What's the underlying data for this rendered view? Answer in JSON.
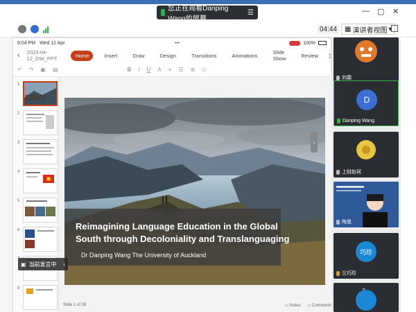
{
  "meeting": {
    "share_banner": "您正在观看Danping Wang的屏幕",
    "timer": "04:44",
    "view_label": "演讲者视图",
    "sharing_tag": "当前发言中"
  },
  "ipad": {
    "time": "6:04 PM",
    "date": "Wed 12 Apr",
    "dots": "•••",
    "battery": "100%"
  },
  "ppt": {
    "filename": "2023-04-12_DW_PPT",
    "tabs": [
      "Home",
      "Insert",
      "Draw",
      "Design",
      "Transitions",
      "Animations",
      "Slide Show",
      "Review"
    ],
    "active_tab": "Home",
    "slide_counter": "Slide 1 of 38",
    "notes_label": "Notes",
    "comments_label": "Comments",
    "thumb_numbers": [
      "1",
      "2",
      "3",
      "4",
      "5",
      "6",
      "7",
      "8"
    ]
  },
  "slide": {
    "title": "Reimagining Language Education in the Global South through Decoloniality and Translanguaging",
    "author": "Dr Danping Wang  The University of Auckland"
  },
  "participants": [
    {
      "name": "刘霜",
      "avatar": "tiger"
    },
    {
      "name": "Danping Wang",
      "avatar": "D",
      "active": true
    },
    {
      "name": "上财赵珂",
      "avatar": "flower"
    },
    {
      "name": "陶思",
      "avatar": "video"
    },
    {
      "name": "兰巧珍",
      "avatar": "巧珍"
    },
    {
      "name": "",
      "avatar": "partial"
    }
  ],
  "colors": {
    "accent": "#c43e1c",
    "active_border": "#3bb34a",
    "avatar_blue": "#3b6fd4"
  }
}
